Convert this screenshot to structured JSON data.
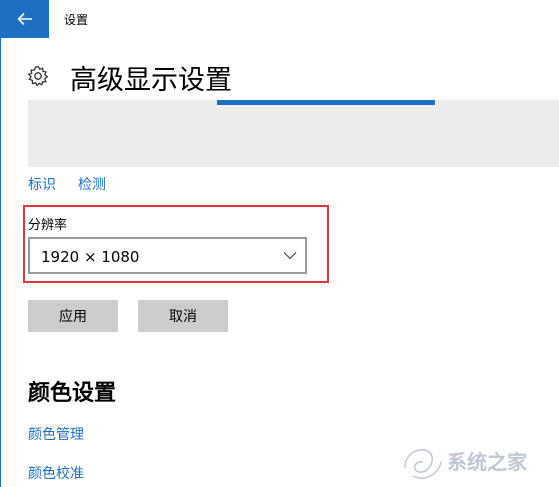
{
  "window": {
    "title": "设置",
    "accent_color": "#1c6fc3"
  },
  "header": {
    "icon": "gear-icon",
    "title": "高级显示设置"
  },
  "display": {
    "identify_label": "标识",
    "detect_label": "检测"
  },
  "resolution": {
    "label": "分辨率",
    "selected": "1920 × 1080",
    "highlight_color": "#e0373f"
  },
  "actions": {
    "apply_label": "应用",
    "cancel_label": "取消"
  },
  "color_settings": {
    "title": "颜色设置",
    "color_management_label": "颜色管理",
    "color_calibration_label": "颜色校准"
  },
  "watermark": {
    "text": "系统之家"
  }
}
